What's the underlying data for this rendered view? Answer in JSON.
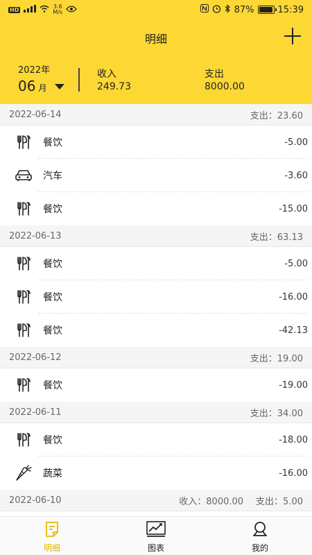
{
  "status_bar": {
    "network": "HD",
    "speed_value": "3.6",
    "speed_unit": "M/s",
    "battery": "87%",
    "battery_level": 0.87,
    "time": "15:39"
  },
  "header": {
    "title": "明细",
    "year": "2022年",
    "month": "06",
    "month_unit": "月",
    "income_label": "收入",
    "income_value": "249.73",
    "expense_label": "支出",
    "expense_value": "8000.00"
  },
  "days": [
    {
      "date": "2022-06-14",
      "income": "",
      "expense": "支出：23.60",
      "items": [
        {
          "icon": "utensils-icon",
          "label": "餐饮",
          "amount": "-5.00"
        },
        {
          "icon": "car-icon",
          "label": "汽车",
          "amount": "-3.60"
        },
        {
          "icon": "utensils-icon",
          "label": "餐饮",
          "amount": "-15.00"
        }
      ]
    },
    {
      "date": "2022-06-13",
      "income": "",
      "expense": "支出：63.13",
      "items": [
        {
          "icon": "utensils-icon",
          "label": "餐饮",
          "amount": "-5.00"
        },
        {
          "icon": "utensils-icon",
          "label": "餐饮",
          "amount": "-16.00"
        },
        {
          "icon": "utensils-icon",
          "label": "餐饮",
          "amount": "-42.13"
        }
      ]
    },
    {
      "date": "2022-06-12",
      "income": "",
      "expense": "支出：19.00",
      "items": [
        {
          "icon": "utensils-icon",
          "label": "餐饮",
          "amount": "-19.00"
        }
      ]
    },
    {
      "date": "2022-06-11",
      "income": "",
      "expense": "支出：34.00",
      "items": [
        {
          "icon": "utensils-icon",
          "label": "餐饮",
          "amount": "-18.00"
        },
        {
          "icon": "carrot-icon",
          "label": "蔬菜",
          "amount": "-16.00"
        }
      ]
    },
    {
      "date": "2022-06-10",
      "income": "收入：8000.00",
      "expense": "支出：5.00",
      "items": []
    }
  ],
  "tabs": [
    {
      "label": "明细",
      "icon": "detail-icon",
      "active": true
    },
    {
      "label": "图表",
      "icon": "chart-icon",
      "active": false
    },
    {
      "label": "我的",
      "icon": "profile-icon",
      "active": false
    }
  ],
  "colors": {
    "accent": "#FDD835",
    "active_tab": "#E6B800"
  }
}
